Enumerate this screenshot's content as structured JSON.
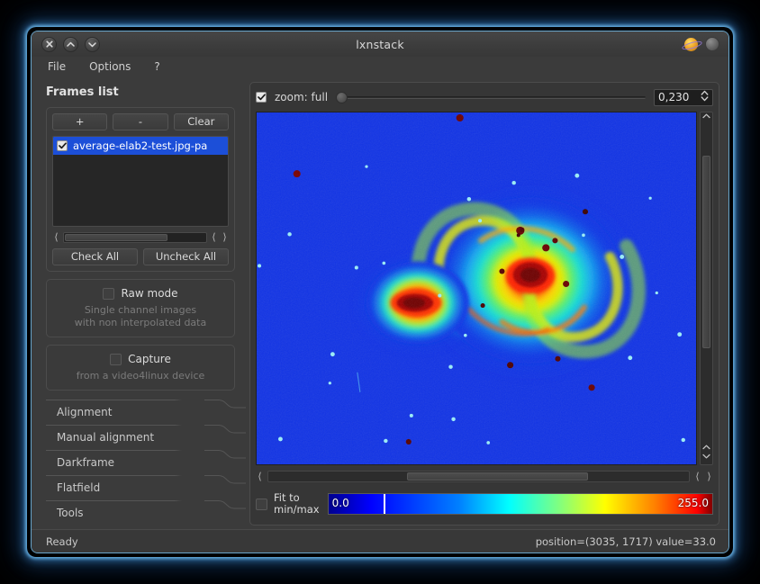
{
  "window": {
    "title": "lxnstack",
    "controls": {
      "close": "close-icon",
      "maximize": "chevron-up-icon",
      "minimize": "chevron-down-icon"
    },
    "right_icons": {
      "planet": "planet-icon",
      "orb": "orb-icon"
    }
  },
  "menubar": {
    "items": [
      {
        "label": "File"
      },
      {
        "label": "Options"
      },
      {
        "label": "?"
      }
    ]
  },
  "sidebar": {
    "title": "Frames list",
    "frame_buttons": [
      {
        "label": "+"
      },
      {
        "label": "-"
      },
      {
        "label": "Clear"
      }
    ],
    "frames": [
      {
        "label": "average-elab2-test.jpg-pa",
        "checked": true,
        "selected": true
      }
    ],
    "check_buttons": [
      {
        "label": "Check All"
      },
      {
        "label": "Uncheck All"
      }
    ],
    "raw_mode": {
      "label": "Raw mode",
      "checked": false,
      "description_line1": "Single channel images",
      "description_line2": "with non interpolated data"
    },
    "capture": {
      "label": "Capture",
      "checked": false,
      "description": "from a video4linux device"
    },
    "tabs": [
      {
        "label": "Alignment"
      },
      {
        "label": "Manual alignment"
      },
      {
        "label": "Darkframe"
      },
      {
        "label": "Flatfield"
      },
      {
        "label": "Tools"
      }
    ]
  },
  "viewer": {
    "zoom": {
      "checked": true,
      "label": "zoom: full",
      "slider_value": 0,
      "spin_value": "0,230",
      "spinner_icon": "up-down-chevron-icon"
    },
    "scroll": {
      "v_up_icon": "chevron-up-icon",
      "v_down_icon": "chevron-down-icon",
      "h_left_icon": "chevron-left-icon",
      "h_right_icon": "chevron-right-icon"
    },
    "fit_to_minmax": {
      "checked": false,
      "label_line1": "Fit to",
      "label_line2": "min/max"
    },
    "colorbar": {
      "min": "0.0",
      "max": "255.0",
      "colormap": "jet",
      "marker_percent": 14.5
    }
  },
  "statusbar": {
    "left": "Ready",
    "right": "position=(3035, 1717) value=33.0"
  },
  "colors": {
    "accent_selection": "#1c4fd8",
    "window_border": "#6aa8cf",
    "panel_bg": "#3b3b3b",
    "image_bg_blue": "#1133e5",
    "glow": "#4e96d2"
  }
}
